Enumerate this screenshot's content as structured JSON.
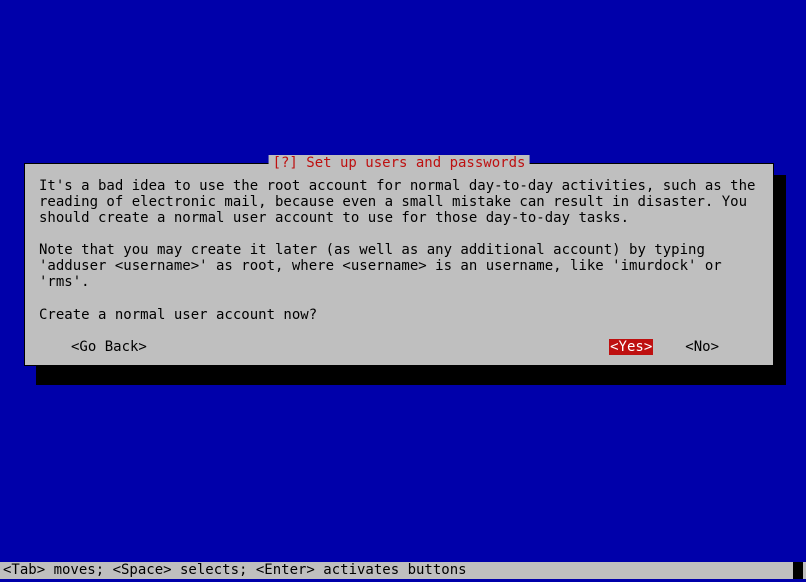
{
  "dialog": {
    "title": "[?] Set up users and passwords",
    "para1": "It's a bad idea to use the root account for normal day-to-day activities, such as the reading of electronic mail, because even a small mistake can result in disaster. You should create a normal user account to use for those day-to-day tasks.",
    "para2": "Note that you may create it later (as well as any additional account) by typing 'adduser <username>' as root, where <username> is an username, like 'imurdock' or 'rms'.",
    "question": "Create a normal user account now?",
    "buttons": {
      "goback": "<Go Back>",
      "yes": "<Yes>",
      "no": "<No>"
    }
  },
  "statusbar": {
    "text": "<Tab> moves; <Space> selects; <Enter> activates buttons"
  }
}
